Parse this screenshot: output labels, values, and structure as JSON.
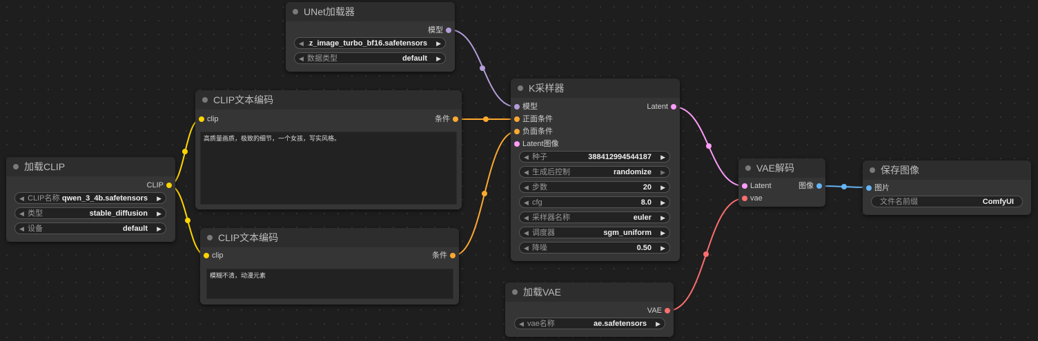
{
  "nodes": {
    "unet": {
      "title": "UNet加载器",
      "output": "模型",
      "widgets": [
        {
          "label": "..",
          "value": "z_image_turbo_bf16.safetensors"
        },
        {
          "label": "数据类型",
          "value": "default"
        }
      ]
    },
    "clip_encode_pos": {
      "title": "CLIP文本编码",
      "input": "clip",
      "output": "条件",
      "text": "高质量画质，极致的细节，一个女孩，写实风格。"
    },
    "clip_encode_neg": {
      "title": "CLIP文本编码",
      "input": "clip",
      "output": "条件",
      "text": "模糊不清，动漫元素"
    },
    "load_clip": {
      "title": "加载CLIP",
      "output": "CLIP",
      "widgets": [
        {
          "label": "CLIP名称",
          "value": "qwen_3_4b.safetensors"
        },
        {
          "label": "类型",
          "value": "stable_diffusion"
        },
        {
          "label": "设备",
          "value": "default"
        }
      ]
    },
    "ksampler": {
      "title": "K采样器",
      "inputs": [
        "模型",
        "正面条件",
        "负面条件",
        "Latent图像"
      ],
      "output": "Latent",
      "widgets": [
        {
          "label": "种子",
          "value": "388412994544187"
        },
        {
          "label": "生成后控制",
          "value": "randomize"
        },
        {
          "label": "步数",
          "value": "20"
        },
        {
          "label": "cfg",
          "value": "8.0"
        },
        {
          "label": "采样器名称",
          "value": "euler"
        },
        {
          "label": "调度器",
          "value": "sgm_uniform"
        },
        {
          "label": "降噪",
          "value": "0.50"
        }
      ]
    },
    "vae_decode": {
      "title": "VAE解码",
      "inputs": [
        "Latent",
        "vae"
      ],
      "output": "图像"
    },
    "save_image": {
      "title": "保存图像",
      "input": "图片",
      "widget": {
        "label": "文件名前缀",
        "value": "ComfyUI"
      }
    },
    "load_vae": {
      "title": "加载VAE",
      "output": "VAE",
      "widget": {
        "label": "vae名称",
        "value": "ae.safetensors"
      }
    }
  },
  "colors": {
    "clip": "#ffd500",
    "conditioning": "#ffa931",
    "model": "#b39ddb",
    "latent": "#ff9cf9",
    "vae": "#ff6e6e",
    "image": "#64b5f6"
  },
  "arrows": {
    "left": "◀",
    "right": "▶"
  }
}
